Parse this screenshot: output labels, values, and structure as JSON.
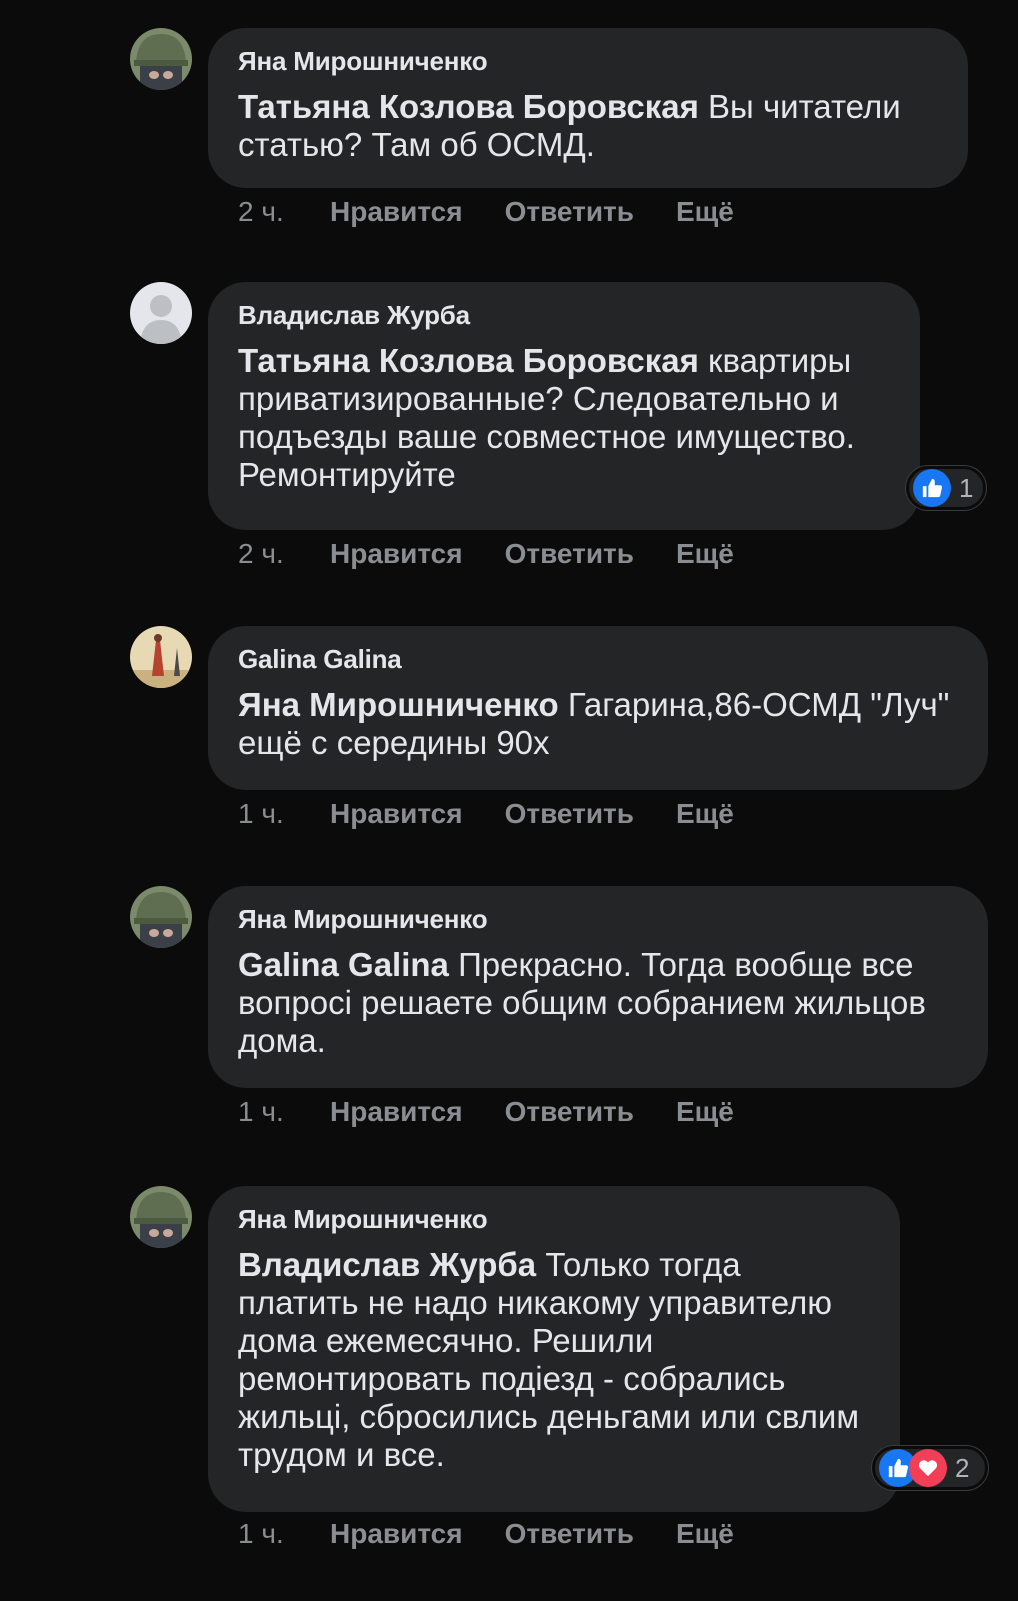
{
  "actions": {
    "like": "Нравится",
    "reply": "Ответить",
    "more": "Ещё"
  },
  "comments": [
    {
      "author": "Яна Мирошниченко",
      "mention": "Татьяна Козлова Боровская",
      "text": " Вы читатели статью? Там об ОСМД.",
      "time": "2 ч.",
      "avatar": "helmet-avatar"
    },
    {
      "author": "Владислав Журба",
      "mention": "Татьяна Козлова Боровская",
      "text": " квартиры приватизированные? Следовательно и подъезды ваше совместное имущество. Ремонтируйте",
      "time": "2 ч.",
      "avatar": "default-avatar",
      "reactions": {
        "icons": [
          "like"
        ],
        "count": "1"
      }
    },
    {
      "author": "Galina Galina",
      "mention": "Яна Мирошниченко",
      "text": " Гагарина,86-ОСМД \"Луч\" ещё с середины 90х",
      "time": "1 ч.",
      "avatar": "photo-avatar"
    },
    {
      "author": "Яна Мирошниченко",
      "mention": "Galina Galina",
      "text": " Прекрасно. Тогда вообще все вопросі решаете общим собранием жильцов дома.",
      "time": "1 ч.",
      "avatar": "helmet-avatar"
    },
    {
      "author": "Яна Мирошниченко",
      "mention": "Владислав Журба",
      "text": " Только тогда платить не надо никакому управителю дома ежемесячно. Решили ремонтировать подіезд - собрались жильці, сбросились деньгами или свлим трудом и все.",
      "time": "1 ч.",
      "avatar": "helmet-avatar",
      "reactions": {
        "icons": [
          "like",
          "love"
        ],
        "count": "2"
      }
    }
  ],
  "colors": {
    "background": "#0b0b0c",
    "bubble": "#242526",
    "meta": "#8a8d91",
    "like": "#1877f2",
    "love": "#f33e58"
  }
}
